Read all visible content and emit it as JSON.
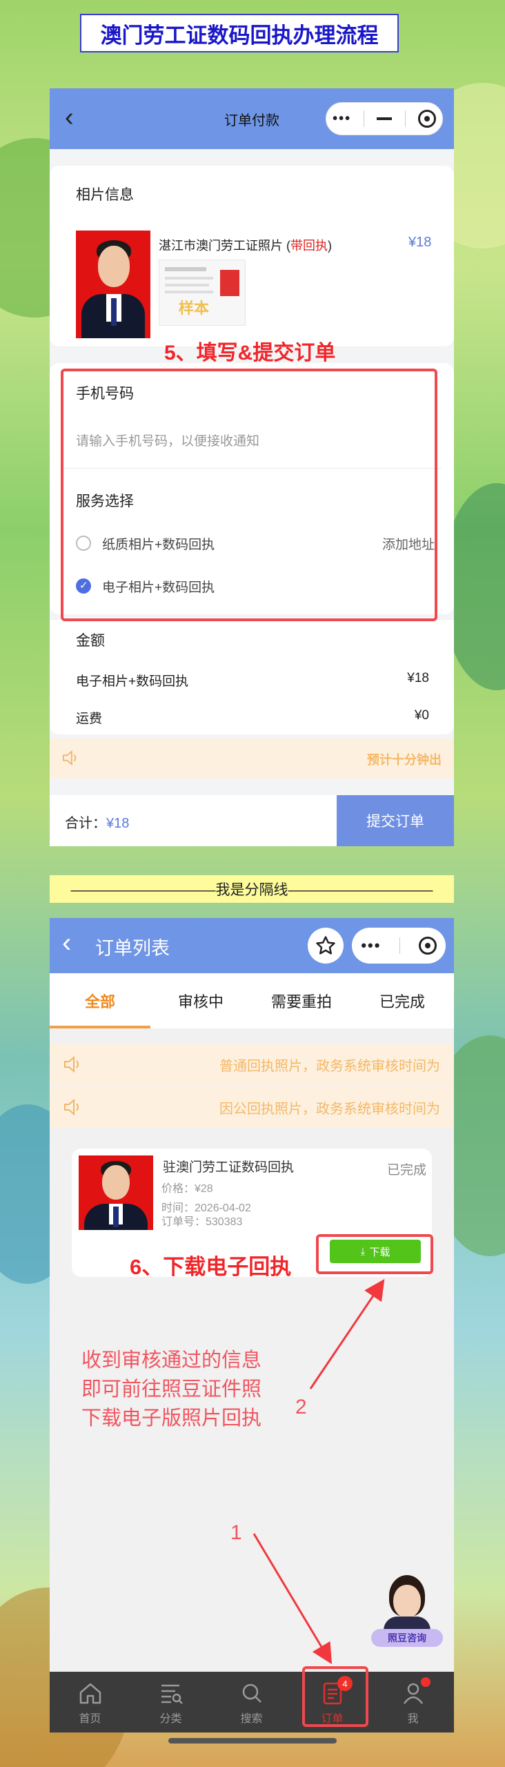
{
  "guide": {
    "title": "澳门劳工证数码回执办理流程",
    "separator": "——————————我是分隔线——————————",
    "annotations": {
      "step5": "5、填写&提交订单",
      "step6": "6、下载电子回执",
      "note": [
        "收到审核通过的信息",
        "即可前往照豆证件照",
        "下载电子版照片回执"
      ],
      "num1": "1",
      "num2": "2"
    }
  },
  "order_payment": {
    "nav_title": "订单付款",
    "photo_section": {
      "title": "相片信息",
      "product_name": "湛江市澳门劳工证照片 (",
      "product_highlight": "带回执",
      "product_close": ")",
      "price": "¥18",
      "sample_stamp": "样本"
    },
    "phone_section": {
      "title": "手机号码",
      "placeholder": "请输入手机号码，以便接收通知"
    },
    "service_section": {
      "title": "服务选择",
      "options": [
        {
          "label": "纸质相片+数码回执",
          "action": "添加地址",
          "selected": false
        },
        {
          "label": "电子相片+数码回执",
          "action": "",
          "selected": true
        }
      ]
    },
    "amount_section": {
      "title": "金额",
      "rows": [
        {
          "label": "电子相片+数码回执",
          "value": "¥18"
        },
        {
          "label": "运费",
          "value": "¥0"
        }
      ]
    },
    "notice": "预计十分钟出",
    "footer": {
      "total_label": "合计：",
      "total_value": "¥18",
      "submit": "提交订单"
    }
  },
  "order_list": {
    "nav_title": "订单列表",
    "tabs": [
      "全部",
      "审核中",
      "需要重拍",
      "已完成"
    ],
    "active_tab": 0,
    "notices": [
      "普通回执照片，政务系统审核时间为",
      "因公回执照片，政务系统审核时间为"
    ],
    "order": {
      "title": "驻澳门劳工证数码回执",
      "status": "已完成",
      "price": "价格：¥28",
      "time": "时间：2026-04-02",
      "order_no": "订单号：530383",
      "download": "下载"
    },
    "consult_label": "照豆咨询",
    "tabbar": [
      {
        "label": "首页",
        "icon": "home-icon"
      },
      {
        "label": "分类",
        "icon": "category-icon"
      },
      {
        "label": "搜索",
        "icon": "search-icon"
      },
      {
        "label": "订单",
        "icon": "order-icon",
        "badge": "4"
      },
      {
        "label": "我",
        "icon": "user-icon"
      }
    ]
  },
  "colors": {
    "nav_blue": "#6f95e6",
    "accent_orange": "#f08a1c",
    "annotation_red": "#f0262a",
    "download_green": "#52c41a"
  }
}
